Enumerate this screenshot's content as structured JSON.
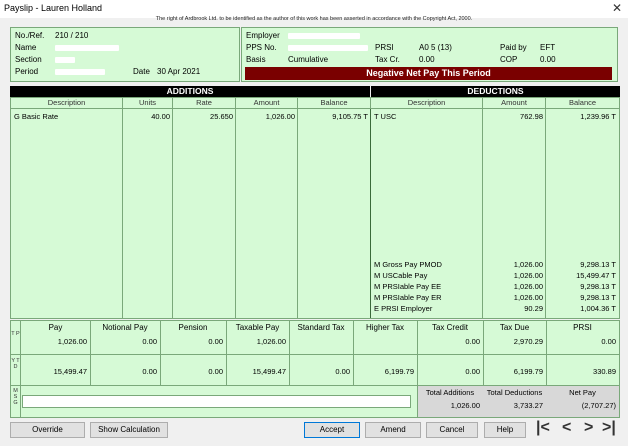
{
  "window": {
    "title": "Payslip - Lauren Holland",
    "close_glyph": "✕"
  },
  "copyright": "The right of Ardbrook Ltd. to be identified as the author of this work has been asserted in accordance with the Copyright Act, 2000.",
  "employee": {
    "noref_label": "No./Ref.",
    "noref_value": "210 / 210",
    "name_label": "Name",
    "section_label": "Section",
    "period_label": "Period",
    "date_label": "Date",
    "date_value": "30 Apr 2021"
  },
  "employer": {
    "employer_label": "Employer",
    "pps_label": "PPS No.",
    "basis_label": "Basis",
    "basis_value": "Cumulative",
    "prsi_label": "PRSI",
    "prsi_value": "A0 5 (13)",
    "taxcr_label": "Tax Cr.",
    "taxcr_value": "0.00",
    "paidby_label": "Paid by",
    "paidby_value": "EFT",
    "cop_label": "COP",
    "cop_value": "0.00",
    "warning": "Negative Net Pay This Period"
  },
  "additions": {
    "header": "ADDITIONS",
    "columns": [
      "Description",
      "Units",
      "Rate",
      "Amount",
      "Balance"
    ],
    "rows": [
      {
        "description": "G Basic Rate",
        "units": "40.00",
        "rate": "25.650",
        "amount": "1,026.00",
        "balance": "9,105.75 T"
      }
    ]
  },
  "deductions": {
    "header": "DEDUCTIONS",
    "columns": [
      "Description",
      "Amount",
      "Balance"
    ],
    "rows": [
      {
        "description": "T USC",
        "amount": "762.98",
        "balance": "1,239.96 T"
      }
    ],
    "info_rows": [
      {
        "description": "M Gross Pay PMOD",
        "amount": "1,026.00",
        "balance": "9,298.13 T"
      },
      {
        "description": "M USCable Pay",
        "amount": "1,026.00",
        "balance": "15,499.47 T"
      },
      {
        "description": "M PRSIable Pay EE",
        "amount": "1,026.00",
        "balance": "9,298.13 T"
      },
      {
        "description": "M PRSIable Pay ER",
        "amount": "1,026.00",
        "balance": "9,298.13 T"
      },
      {
        "description": "E PRSI Employer",
        "amount": "90.29",
        "balance": "1,004.36 T"
      }
    ]
  },
  "summary": {
    "columns": [
      "Pay",
      "Notional Pay",
      "Pension",
      "Taxable Pay",
      "Standard Tax",
      "Higher Tax",
      "Tax Credit",
      "Tax Due",
      "PRSI"
    ],
    "tp_label": "T P",
    "tp": [
      "1,026.00",
      "0.00",
      "0.00",
      "1,026.00",
      "",
      "",
      "0.00",
      "2,970.29",
      "0.00"
    ],
    "ytd_label": "Y T D",
    "ytd": [
      "15,499.47",
      "0.00",
      "0.00",
      "15,499.47",
      "0.00",
      "6,199.79",
      "0.00",
      "6,199.79",
      "330.89"
    ],
    "msg_label": "M S G",
    "total_additions_label": "Total Additions",
    "total_additions": "1,026.00",
    "total_deductions_label": "Total Deductions",
    "total_deductions": "3,733.27",
    "net_pay_label": "Net Pay",
    "net_pay": "(2,707.27)"
  },
  "buttons": {
    "override": "Override",
    "show_calc": "Show Calculation",
    "accept": "Accept",
    "amend": "Amend",
    "cancel": "Cancel",
    "help": "Help"
  },
  "nav": {
    "first": "|<",
    "prev": "<",
    "next": ">",
    "last": ">|"
  }
}
